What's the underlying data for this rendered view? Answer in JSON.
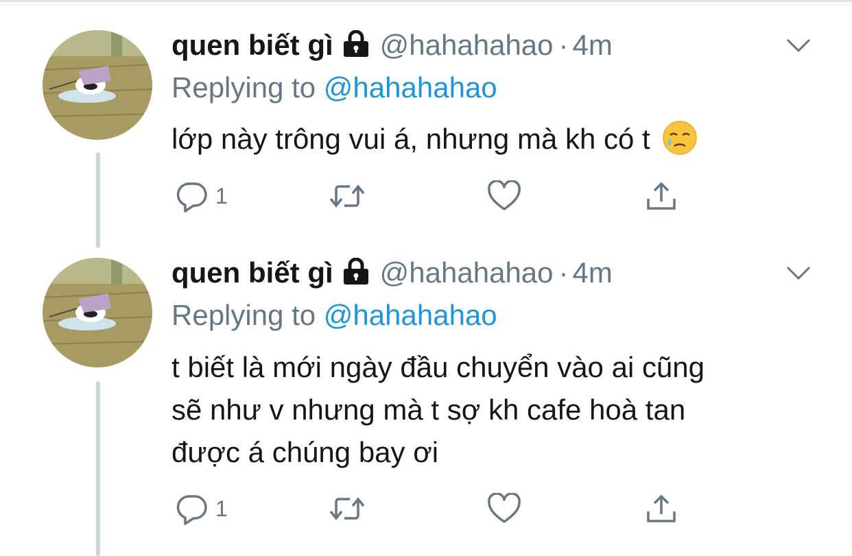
{
  "tweets": [
    {
      "name": "quen biết gì",
      "handle": "@hahahahao",
      "separator": "·",
      "time": "4m",
      "replying_prefix": "Replying to",
      "replying_mention": "@hahahahao",
      "text": "lớp này trông vui á, nhưng mà kh có t",
      "emoji": "crying-face-with-tear",
      "reply_count": "1",
      "icons": [
        "reply-icon",
        "retweet-icon",
        "like-icon",
        "share-icon",
        "lock-icon",
        "chevron-down-icon"
      ]
    },
    {
      "name": "quen biết gì",
      "handle": "@hahahahao",
      "separator": "·",
      "time": "4m",
      "replying_prefix": "Replying to",
      "replying_mention": "@hahahahao",
      "text_lines": [
        "t biết là mới ngày đầu chuyển vào ai cũng",
        "sẽ như v nhưng mà t sợ kh cafe hoà tan",
        "được á chúng bay ơi"
      ],
      "reply_count": "1",
      "icons": [
        "reply-icon",
        "retweet-icon",
        "like-icon",
        "share-icon",
        "lock-icon",
        "chevron-down-icon"
      ]
    }
  ],
  "colors": {
    "text": "#14171a",
    "secondary": "#657786",
    "link": "#1b95e0",
    "thread_line": "#ccd6dd"
  }
}
